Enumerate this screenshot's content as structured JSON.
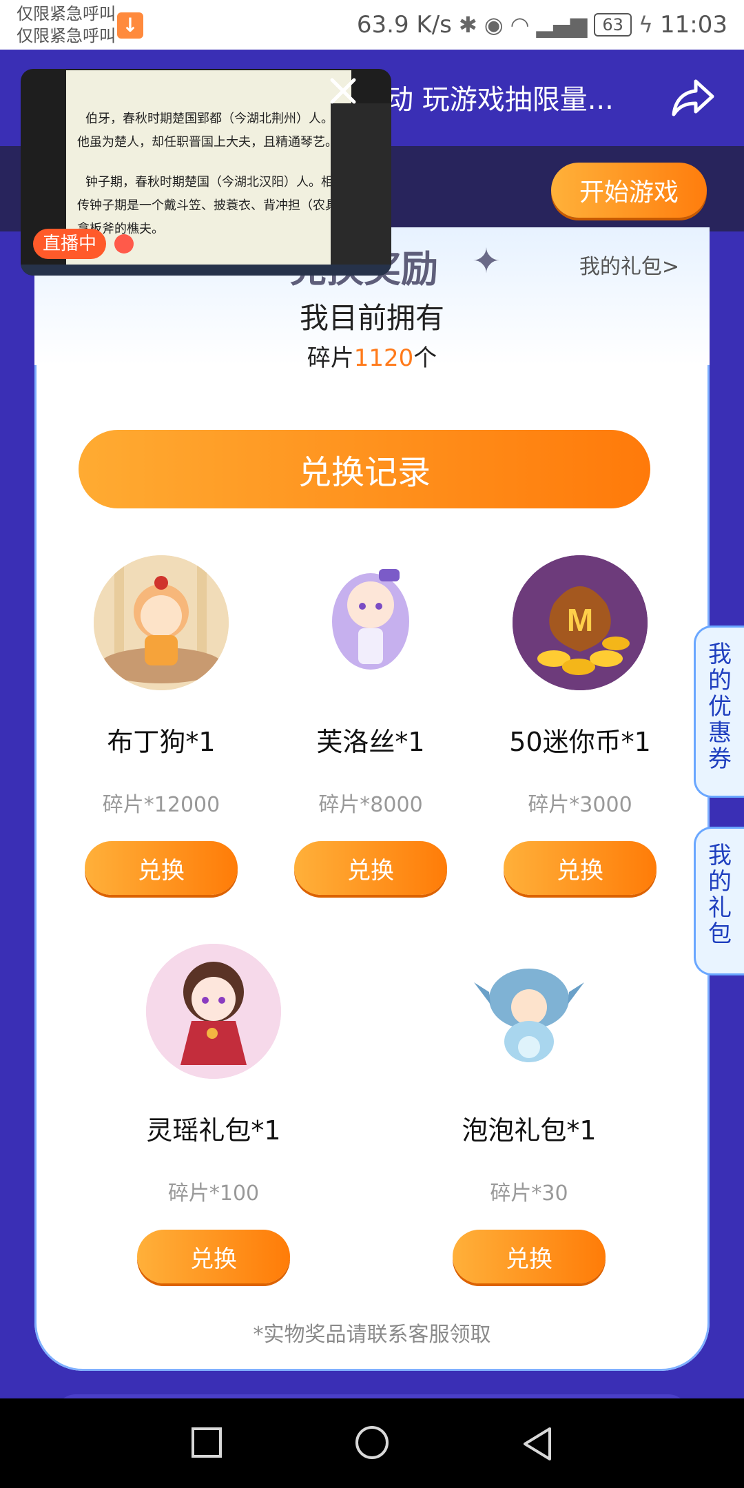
{
  "status_bar": {
    "carrier_line1": "仅限紧急呼叫",
    "carrier_line2": "仅限紧急呼叫",
    "speed": "63.9 K/s",
    "battery": "63",
    "time": "11:03"
  },
  "header": {
    "title": "动 玩游戏抽限量..."
  },
  "start_game_label": "开始游戏",
  "exchange": {
    "title": "兑换奖励",
    "my_gift_link": "我的礼包>"
  },
  "own": {
    "title": "我目前拥有",
    "prefix": "碎片",
    "count": "1120",
    "suffix": "个"
  },
  "record_button": "兑换记录",
  "items": [
    {
      "name": "布丁狗*1",
      "cost": "碎片*12000",
      "button": "兑换"
    },
    {
      "name": "芙洛丝*1",
      "cost": "碎片*8000",
      "button": "兑换"
    },
    {
      "name": "50迷你币*1",
      "cost": "碎片*3000",
      "button": "兑换"
    },
    {
      "name": "灵瑶礼包*1",
      "cost": "碎片*100",
      "button": "兑换"
    },
    {
      "name": "泡泡礼包*1",
      "cost": "碎片*30",
      "button": "兑换"
    }
  ],
  "note": "*实物奖品请联系客服领取",
  "side_tabs": {
    "coupon": "我的优惠券",
    "gift": "我的礼包"
  },
  "pip": {
    "live_label": "直播中",
    "doc_lines": [
      "伯牙，春秋时期楚国郢都（今湖北荆州）人。",
      "他虽为楚人，却任职晋国上大夫，且精通琴艺。",
      "钟子期，春秋时期楚国（今湖北汉阳）人。相",
      "传钟子期是一个戴斗笠、披蓑衣、背冲担（农具）",
      "拿板斧的樵夫。"
    ]
  },
  "colors": {
    "page_bg": "#3a2fb5",
    "accent_orange": "#ff7d0d",
    "side_tab_text": "#1f3fbf"
  }
}
